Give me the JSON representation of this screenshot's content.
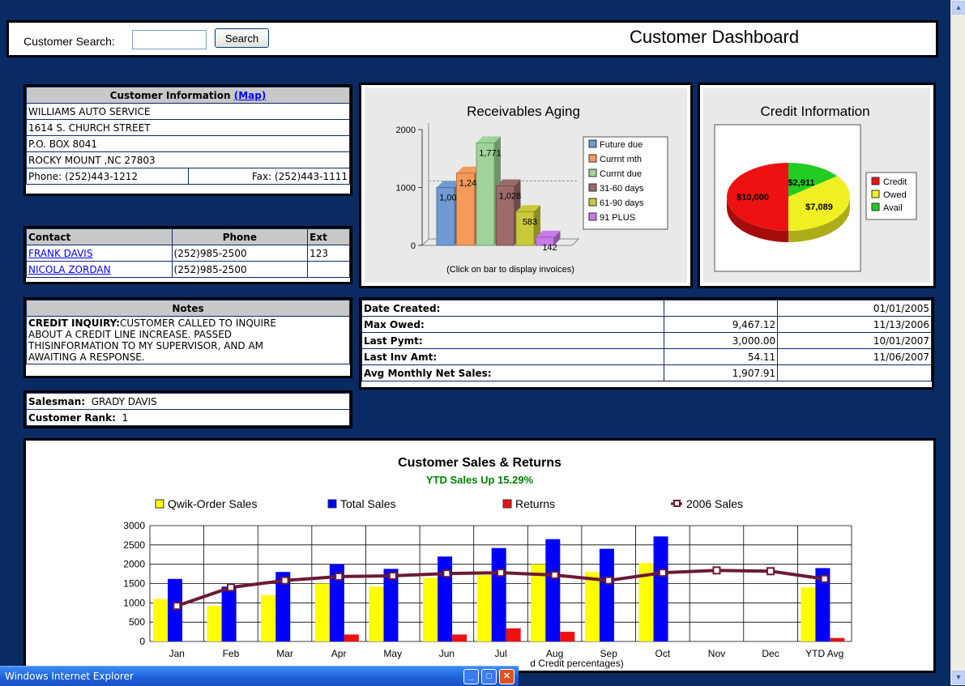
{
  "window": {
    "taskbar_title": "Windows Internet Explorer"
  },
  "header": {
    "search_label": "Customer Search:",
    "search_value": "",
    "search_button": "Search",
    "title": "Customer Dashboard"
  },
  "customer": {
    "header": "Customer Information",
    "map_link": "(Map)",
    "name": "WILLIAMS AUTO SERVICE",
    "address1": "1614 S. CHURCH STREET",
    "address2": "P.O. BOX 8041",
    "city": "ROCKY MOUNT ,NC  27803",
    "phone": "Phone: (252)443-1212",
    "fax": "Fax: (252)443-1111"
  },
  "contacts": {
    "headers": [
      "Contact",
      "Phone",
      "Ext"
    ],
    "rows": [
      {
        "name": "FRANK DAVIS",
        "phone": "(252)985-2500",
        "ext": "123"
      },
      {
        "name": "NICOLA ZORDAN",
        "phone": "(252)985-2500",
        "ext": ""
      }
    ]
  },
  "notes": {
    "header": "Notes",
    "label": "CREDIT INQUIRY:",
    "line1": "CUSTOMER CALLED TO INQUIRE",
    "line2": "ABOUT A CREDIT LINE INCREASE. PASSED",
    "line3": "THISINFORMATION TO MY SUPERVISOR, AND AM",
    "line4": "AWAITING A RESPONSE."
  },
  "sales": {
    "salesman_label": "Salesman:",
    "salesman": "GRADY DAVIS",
    "rank_label": "Customer Rank:",
    "rank": "1"
  },
  "stats": [
    {
      "label": "Date Created:",
      "value": "",
      "date": "01/01/2005"
    },
    {
      "label": "Max Owed:",
      "value": "9,467.12",
      "date": "11/13/2006"
    },
    {
      "label": "Last Pymt:",
      "value": "3,000.00",
      "date": "10/01/2007"
    },
    {
      "label": "Last Inv Amt:",
      "value": "54.11",
      "date": "11/06/2007"
    },
    {
      "label": "Avg Monthly Net Sales:",
      "value": "1,907.91",
      "date": ""
    }
  ],
  "colors": {
    "background": "#0a2a63",
    "header_gray": "#c8c8c8",
    "link": "#0000ff"
  },
  "chart_data": [
    {
      "type": "bar",
      "title": "Receivables Aging",
      "caption": "(Click on bar to display invoices)",
      "categories": [
        "Future due",
        "Currnt mth",
        "Currnt due",
        "31-60 days",
        "61-90 days",
        "91 PLUS"
      ],
      "values": [
        1000,
        1249,
        1771,
        1028,
        583,
        142
      ],
      "value_labels": [
        "1,000",
        "1,249",
        "1,771",
        "1,028",
        "583",
        "142"
      ],
      "colors": [
        "#6f9ad3",
        "#f49a5a",
        "#9fd39a",
        "#9b6a6a",
        "#c9c93a",
        "#c77be8"
      ],
      "ylim": [
        0,
        2000
      ],
      "yticks": [
        "0",
        "1000",
        "2000"
      ],
      "legend": "right"
    },
    {
      "type": "pie",
      "title": "Credit Information",
      "slices": [
        {
          "name": "Credit",
          "value": 10000,
          "label": "$10,000",
          "color": "#ee1111"
        },
        {
          "name": "Owed",
          "value": 7089,
          "label": "$7,089",
          "color": "#f0f022"
        },
        {
          "name": "Avail",
          "value": 2911,
          "label": "$2,911",
          "color": "#22cc22"
        }
      ],
      "legend": "right"
    },
    {
      "type": "bar",
      "title": "Customer Sales & Returns",
      "subtitle": "YTD Sales Up 15.29%",
      "caption": "d Credit percentages)",
      "categories": [
        "Jan",
        "Feb",
        "Mar",
        "Apr",
        "May",
        "Jun",
        "Jul",
        "Aug",
        "Sep",
        "Oct",
        "Nov",
        "Dec",
        "YTD Avg"
      ],
      "ylim": [
        0,
        3000
      ],
      "yticks": [
        "0",
        "500",
        "1000",
        "1500",
        "2000",
        "2500",
        "3000"
      ],
      "legend": "top",
      "series": [
        {
          "name": "Qwik-Order Sales",
          "color": "#ffff00",
          "values": [
            1100,
            920,
            1200,
            1500,
            1420,
            1650,
            1720,
            2000,
            1800,
            2030,
            0,
            0,
            1400
          ]
        },
        {
          "name": "Total Sales",
          "color": "#0000ff",
          "values": [
            1620,
            1420,
            1800,
            2000,
            1880,
            2200,
            2420,
            2650,
            2400,
            2720,
            0,
            0,
            1900
          ]
        },
        {
          "name": "Returns",
          "color": "#ee1111",
          "values": [
            0,
            0,
            0,
            180,
            0,
            180,
            340,
            250,
            0,
            0,
            0,
            0,
            90
          ]
        },
        {
          "name": "2006 Sales",
          "color": "#6b1a36",
          "type": "line",
          "values": [
            920,
            1400,
            1580,
            1680,
            1700,
            1760,
            1780,
            1720,
            1580,
            1780,
            1840,
            1820,
            1620
          ]
        }
      ]
    }
  ]
}
